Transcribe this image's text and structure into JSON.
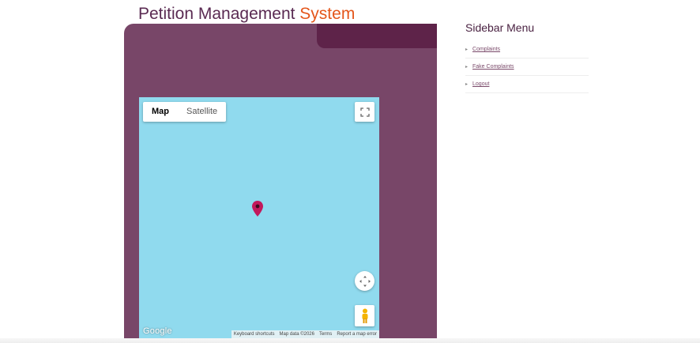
{
  "header": {
    "title_main": "Petition Management ",
    "title_accent": "System"
  },
  "map": {
    "type_buttons": [
      "Map",
      "Satellite"
    ],
    "active_type": "Map",
    "logo": "Google",
    "footer": [
      "Keyboard shortcuts",
      "Map data ©2026",
      "Terms",
      "Report a map error"
    ],
    "marker_color": "#c2185b"
  },
  "sidebar": {
    "title": "Sidebar Menu",
    "items": [
      {
        "label": "Complaints"
      },
      {
        "label": "Fake Complaints"
      },
      {
        "label": "Logout"
      }
    ]
  },
  "colors": {
    "panel": "#784668",
    "panel_tab": "#5e2349",
    "accent": "#e4561b",
    "water": "#90daee"
  }
}
